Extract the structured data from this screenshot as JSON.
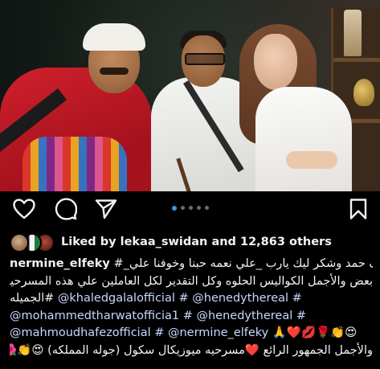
{
  "post": {
    "carousel": {
      "count": 5,
      "active_index": 0
    },
    "likes": {
      "liked_by_prefix": "Liked by",
      "user": "lekaa_swidan",
      "conjunction": "and",
      "others": "12,863 others"
    },
    "caption": {
      "username": "nermine_elfeky",
      "line1_arabic": "الف حمد وشكر ليك يارب _علي نعمه حبنا وخوفنا علي_#",
      "line2": "بعض والأجمل الكواليس الحلوه وكل التقدير لكل العاملين علي هذه المسرحيه",
      "line3_prefix": "الجميله#",
      "line3_tags": [
        "@khaledgalalofficial",
        "#",
        "@henedythereal",
        "#"
      ],
      "line4_tags": [
        "@mohammedtharwatofficia1",
        "#",
        "@henedythereal",
        "#"
      ],
      "line5_tags": [
        "@mahmoudhafezofficial",
        "#",
        "@nermine_elfeky"
      ],
      "line5_emoji": "🙏❤️💋🌹👏😍",
      "line6_arabic": "والأجمل الجمهور الرائع ❤️مسرحيه ميوزيكال سكول (جوله المملكه)",
      "line6_emoji": "😍👏🌺"
    }
  },
  "icons": {
    "like": "heart-icon",
    "comment": "comment-icon",
    "share": "send-icon",
    "save": "bookmark-icon"
  },
  "colors": {
    "background": "#000000",
    "text": "#f2f2f2",
    "mention": "#c9d7ff",
    "active_dot": "#3897f0",
    "inactive_dot": "#6b6b6b"
  }
}
